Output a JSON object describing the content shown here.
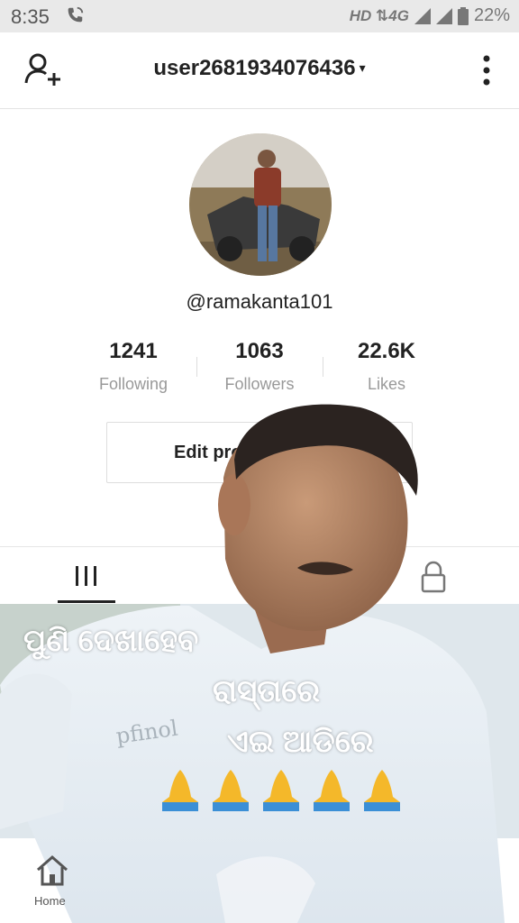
{
  "status_bar": {
    "time": "8:35",
    "network": "HD ⇅4G",
    "battery": "22%"
  },
  "header": {
    "username": "user2681934076436",
    "caret": "▾"
  },
  "profile": {
    "handle": "@ramakanta101",
    "stats": [
      {
        "value": "1241",
        "label": "Following"
      },
      {
        "value": "1063",
        "label": "Followers"
      },
      {
        "value": "22.6K",
        "label": "Likes"
      }
    ],
    "edit_button": "Edit pro"
  },
  "overlay": {
    "caption_lines": [
      "ପୁଣି  ଦେଖାହେବ",
      "ରାସ୍ତାରେ",
      "ଏଇ ଆଡିରେ"
    ],
    "emoji_count": 5
  },
  "nav": {
    "home_label": "Home"
  }
}
